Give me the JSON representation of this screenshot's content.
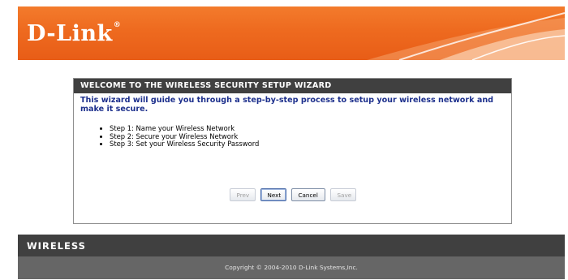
{
  "brand": {
    "logo_text": "D-Link",
    "registered_mark": "®"
  },
  "wizard": {
    "title": "WELCOME TO THE WIRELESS SECURITY SETUP WIZARD",
    "intro": "This wizard will guide you through a step-by-step process to setup your wireless network and make it secure.",
    "steps": [
      "Step 1: Name your Wireless Network",
      "Step 2: Secure your Wireless Network",
      "Step 3: Set your Wireless Security Password"
    ],
    "buttons": {
      "prev": "Prev",
      "next": "Next",
      "cancel": "Cancel",
      "save": "Save"
    },
    "button_states": {
      "prev": "disabled",
      "next": "enabled",
      "cancel": "enabled",
      "save": "disabled"
    }
  },
  "footer": {
    "section_label": "WIRELESS",
    "copyright": "Copyright © 2004-2010 D-Link Systems,Inc."
  },
  "colors": {
    "header_orange": "#ee6a1f",
    "panel_title_bg": "#404040",
    "intro_text": "#1c2f8c",
    "footer_dark": "#404040",
    "copyright_bg": "#666666"
  }
}
